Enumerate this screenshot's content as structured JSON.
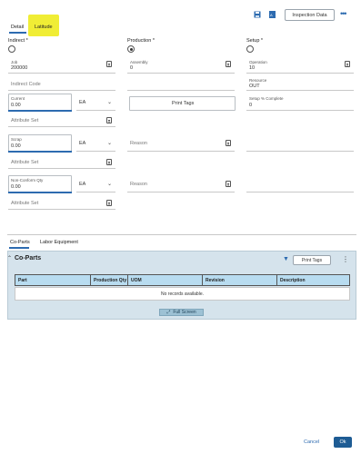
{
  "toolbar": {
    "inspection_label": "Inspection Data",
    "more_label": "•••"
  },
  "tabs": {
    "detail": "Detail",
    "latitude": "Latitude"
  },
  "fields": {
    "indirect_label": "Indirect *",
    "production_label": "Production *",
    "setup_label": "Setup *",
    "job_label": "Job",
    "job_value": "200000",
    "assembly_label": "Assembly",
    "assembly_value": "0",
    "operation_label": "Operation",
    "operation_value": "10",
    "indirect_code": "Indirect Code",
    "resource_label": "Resource",
    "resource_value": "OUT",
    "setup_complete_label": "Setup % Complete",
    "setup_complete_value": "0",
    "current_label": "Current",
    "current_value": "0.00",
    "current_uom": "EA",
    "print_tags": "Print Tags",
    "attribute_set": "Attribute Set",
    "scrap_label": "Scrap",
    "scrap_value": "0.00",
    "scrap_uom": "EA",
    "reason": "Reason",
    "nonconform_label": "Non-Conform Qty",
    "nonconform_value": "0.00",
    "nonconform_uom": "EA"
  },
  "subtabs": {
    "coparts": "Co-Parts",
    "labor": "Labor Equipment"
  },
  "grid": {
    "title": "Co-Parts",
    "print_tags": "Print Tags",
    "columns": [
      "Part",
      "Production Qty",
      "UOM",
      "Revision",
      "Description"
    ],
    "empty": "No records available.",
    "full_screen": "Full Screen"
  },
  "footer": {
    "cancel": "Cancel",
    "ok": "Ok"
  }
}
